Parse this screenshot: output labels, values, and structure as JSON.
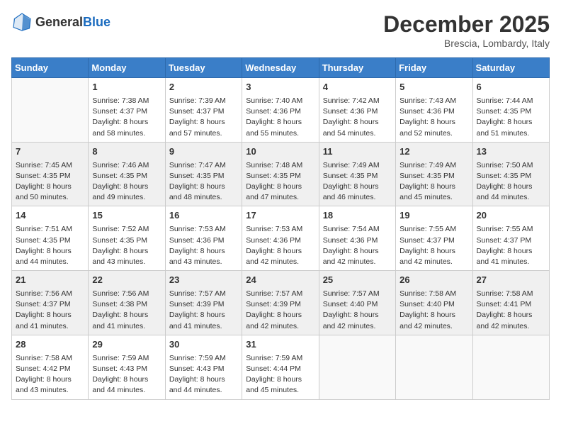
{
  "header": {
    "logo_general": "General",
    "logo_blue": "Blue",
    "month_title": "December 2025",
    "location": "Brescia, Lombardy, Italy"
  },
  "days_of_week": [
    "Sunday",
    "Monday",
    "Tuesday",
    "Wednesday",
    "Thursday",
    "Friday",
    "Saturday"
  ],
  "weeks": [
    [
      {
        "day": "",
        "info": ""
      },
      {
        "day": "1",
        "info": "Sunrise: 7:38 AM\nSunset: 4:37 PM\nDaylight: 8 hours\nand 58 minutes."
      },
      {
        "day": "2",
        "info": "Sunrise: 7:39 AM\nSunset: 4:37 PM\nDaylight: 8 hours\nand 57 minutes."
      },
      {
        "day": "3",
        "info": "Sunrise: 7:40 AM\nSunset: 4:36 PM\nDaylight: 8 hours\nand 55 minutes."
      },
      {
        "day": "4",
        "info": "Sunrise: 7:42 AM\nSunset: 4:36 PM\nDaylight: 8 hours\nand 54 minutes."
      },
      {
        "day": "5",
        "info": "Sunrise: 7:43 AM\nSunset: 4:36 PM\nDaylight: 8 hours\nand 52 minutes."
      },
      {
        "day": "6",
        "info": "Sunrise: 7:44 AM\nSunset: 4:35 PM\nDaylight: 8 hours\nand 51 minutes."
      }
    ],
    [
      {
        "day": "7",
        "info": "Sunrise: 7:45 AM\nSunset: 4:35 PM\nDaylight: 8 hours\nand 50 minutes."
      },
      {
        "day": "8",
        "info": "Sunrise: 7:46 AM\nSunset: 4:35 PM\nDaylight: 8 hours\nand 49 minutes."
      },
      {
        "day": "9",
        "info": "Sunrise: 7:47 AM\nSunset: 4:35 PM\nDaylight: 8 hours\nand 48 minutes."
      },
      {
        "day": "10",
        "info": "Sunrise: 7:48 AM\nSunset: 4:35 PM\nDaylight: 8 hours\nand 47 minutes."
      },
      {
        "day": "11",
        "info": "Sunrise: 7:49 AM\nSunset: 4:35 PM\nDaylight: 8 hours\nand 46 minutes."
      },
      {
        "day": "12",
        "info": "Sunrise: 7:49 AM\nSunset: 4:35 PM\nDaylight: 8 hours\nand 45 minutes."
      },
      {
        "day": "13",
        "info": "Sunrise: 7:50 AM\nSunset: 4:35 PM\nDaylight: 8 hours\nand 44 minutes."
      }
    ],
    [
      {
        "day": "14",
        "info": "Sunrise: 7:51 AM\nSunset: 4:35 PM\nDaylight: 8 hours\nand 44 minutes."
      },
      {
        "day": "15",
        "info": "Sunrise: 7:52 AM\nSunset: 4:35 PM\nDaylight: 8 hours\nand 43 minutes."
      },
      {
        "day": "16",
        "info": "Sunrise: 7:53 AM\nSunset: 4:36 PM\nDaylight: 8 hours\nand 43 minutes."
      },
      {
        "day": "17",
        "info": "Sunrise: 7:53 AM\nSunset: 4:36 PM\nDaylight: 8 hours\nand 42 minutes."
      },
      {
        "day": "18",
        "info": "Sunrise: 7:54 AM\nSunset: 4:36 PM\nDaylight: 8 hours\nand 42 minutes."
      },
      {
        "day": "19",
        "info": "Sunrise: 7:55 AM\nSunset: 4:37 PM\nDaylight: 8 hours\nand 42 minutes."
      },
      {
        "day": "20",
        "info": "Sunrise: 7:55 AM\nSunset: 4:37 PM\nDaylight: 8 hours\nand 41 minutes."
      }
    ],
    [
      {
        "day": "21",
        "info": "Sunrise: 7:56 AM\nSunset: 4:37 PM\nDaylight: 8 hours\nand 41 minutes."
      },
      {
        "day": "22",
        "info": "Sunrise: 7:56 AM\nSunset: 4:38 PM\nDaylight: 8 hours\nand 41 minutes."
      },
      {
        "day": "23",
        "info": "Sunrise: 7:57 AM\nSunset: 4:39 PM\nDaylight: 8 hours\nand 41 minutes."
      },
      {
        "day": "24",
        "info": "Sunrise: 7:57 AM\nSunset: 4:39 PM\nDaylight: 8 hours\nand 42 minutes."
      },
      {
        "day": "25",
        "info": "Sunrise: 7:57 AM\nSunset: 4:40 PM\nDaylight: 8 hours\nand 42 minutes."
      },
      {
        "day": "26",
        "info": "Sunrise: 7:58 AM\nSunset: 4:40 PM\nDaylight: 8 hours\nand 42 minutes."
      },
      {
        "day": "27",
        "info": "Sunrise: 7:58 AM\nSunset: 4:41 PM\nDaylight: 8 hours\nand 42 minutes."
      }
    ],
    [
      {
        "day": "28",
        "info": "Sunrise: 7:58 AM\nSunset: 4:42 PM\nDaylight: 8 hours\nand 43 minutes."
      },
      {
        "day": "29",
        "info": "Sunrise: 7:59 AM\nSunset: 4:43 PM\nDaylight: 8 hours\nand 44 minutes."
      },
      {
        "day": "30",
        "info": "Sunrise: 7:59 AM\nSunset: 4:43 PM\nDaylight: 8 hours\nand 44 minutes."
      },
      {
        "day": "31",
        "info": "Sunrise: 7:59 AM\nSunset: 4:44 PM\nDaylight: 8 hours\nand 45 minutes."
      },
      {
        "day": "",
        "info": ""
      },
      {
        "day": "",
        "info": ""
      },
      {
        "day": "",
        "info": ""
      }
    ]
  ]
}
